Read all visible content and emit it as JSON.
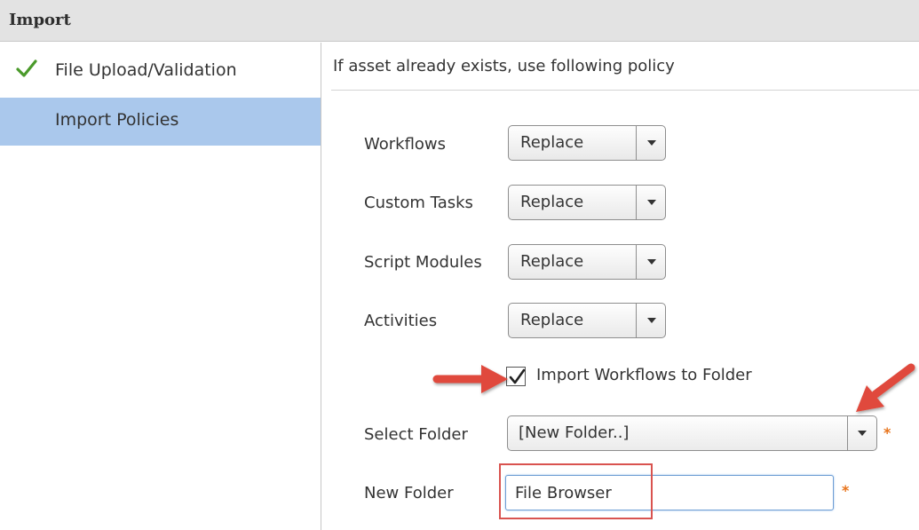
{
  "window": {
    "title": "Import"
  },
  "sidebar": {
    "steps": [
      {
        "label": "File Upload/Validation",
        "status": "complete",
        "icon": "checkmark-icon"
      },
      {
        "label": "Import Policies",
        "status": "active"
      }
    ]
  },
  "policy": {
    "header": "If asset already exists, use following policy",
    "rows": [
      {
        "label": "Workflows",
        "value": "Replace"
      },
      {
        "label": "Custom Tasks",
        "value": "Replace"
      },
      {
        "label": "Script Modules",
        "value": "Replace"
      },
      {
        "label": "Activities",
        "value": "Replace"
      }
    ],
    "import_to_folder": {
      "label": "Import Workflows to Folder",
      "checked": true
    },
    "select_folder": {
      "label": "Select Folder",
      "value": "[New Folder..]",
      "required_mark": "*"
    },
    "new_folder": {
      "label": "New Folder",
      "value": "File Browser",
      "required_mark": "*"
    }
  },
  "colors": {
    "active_step_bg": "#aac8ec",
    "check_green": "#4a9a2a",
    "required": "#e8731a",
    "annotation_red": "#d9534f"
  }
}
